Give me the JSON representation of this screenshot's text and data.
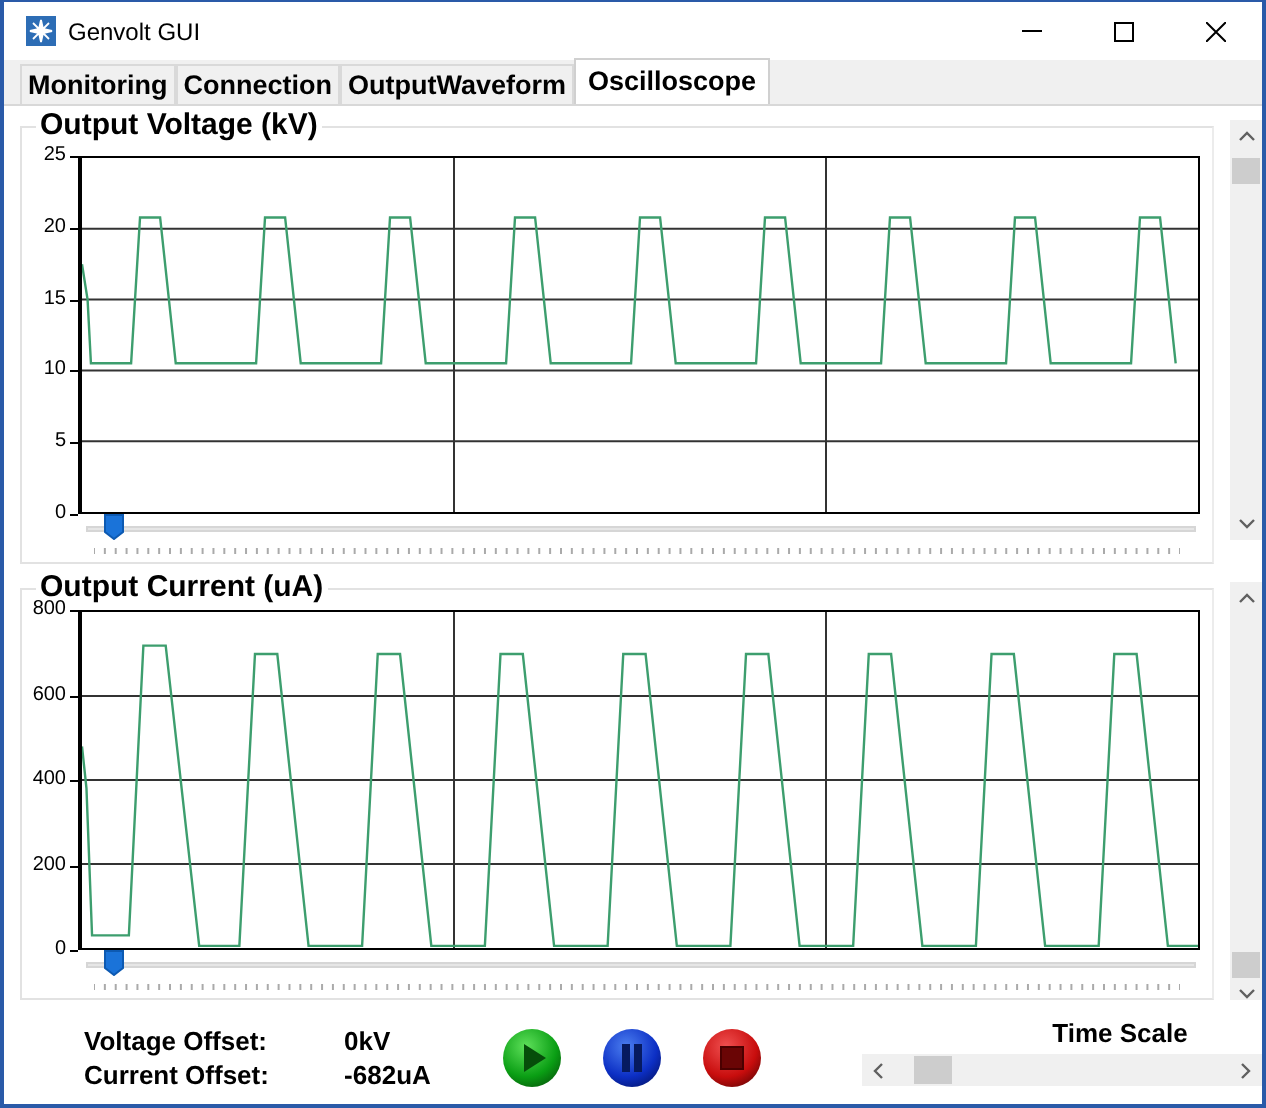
{
  "window": {
    "title": "Genvolt GUI"
  },
  "tabs": [
    {
      "label": "Monitoring",
      "selected": false
    },
    {
      "label": "Connection",
      "selected": false
    },
    {
      "label": "OutputWaveform",
      "selected": false
    },
    {
      "label": "Oscilloscope",
      "selected": true
    }
  ],
  "panels": [
    {
      "kind": "voltage",
      "title": "Output Voltage (kV)",
      "y_ticks": [
        "25",
        "20",
        "15",
        "10",
        "5",
        "0"
      ],
      "slider": {
        "level": 0.01
      }
    },
    {
      "kind": "current",
      "title": "Output Current (uA)",
      "y_ticks": [
        "800",
        "600",
        "400",
        "200",
        "0"
      ],
      "slider": {
        "level": 0.01
      }
    }
  ],
  "offsets": [
    {
      "label": "Voltage Offset:",
      "value": "0kV"
    },
    {
      "label": "Current Offset:",
      "value": "-682uA"
    }
  ],
  "buttons": [
    {
      "kind": "play"
    },
    {
      "kind": "pause"
    },
    {
      "kind": "stop"
    }
  ],
  "time_scale": {
    "label": "Time Scale"
  }
}
